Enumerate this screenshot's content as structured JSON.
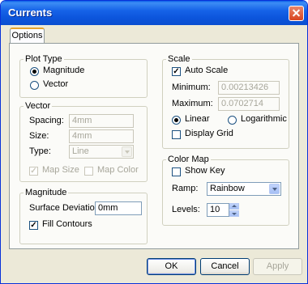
{
  "window": {
    "title": "Currents"
  },
  "tabs": [
    {
      "label": "Options"
    }
  ],
  "plot_type": {
    "legend": "Plot Type",
    "options": [
      {
        "label": "Magnitude",
        "selected": true
      },
      {
        "label": "Vector",
        "selected": false
      }
    ]
  },
  "vector": {
    "legend": "Vector",
    "spacing_label": "Spacing:",
    "spacing_value": "4mm",
    "size_label": "Size:",
    "size_value": "4mm",
    "type_label": "Type:",
    "type_value": "Line",
    "map_size_label": "Map Size",
    "map_size_checked": true,
    "map_color_label": "Map Color",
    "map_color_checked": false
  },
  "magnitude": {
    "legend": "Magnitude",
    "surface_deviation_label": "Surface Deviation:",
    "surface_deviation_value": "0mm",
    "fill_contours_label": "Fill Contours",
    "fill_contours_checked": true
  },
  "scale": {
    "legend": "Scale",
    "auto_scale_label": "Auto Scale",
    "auto_scale_checked": true,
    "minimum_label": "Minimum:",
    "minimum_value": "0.00213426",
    "maximum_label": "Maximum:",
    "maximum_value": "0.0702714",
    "linear_label": "Linear",
    "linear_selected": true,
    "logarithmic_label": "Logarithmic",
    "logarithmic_selected": false,
    "display_grid_label": "Display Grid",
    "display_grid_checked": false
  },
  "color_map": {
    "legend": "Color Map",
    "show_key_label": "Show Key",
    "show_key_checked": false,
    "ramp_label": "Ramp:",
    "ramp_value": "Rainbow",
    "levels_label": "Levels:",
    "levels_value": "10"
  },
  "buttons": {
    "ok": "OK",
    "cancel": "Cancel",
    "apply": "Apply"
  },
  "colors": {
    "title_bar": "#0a5fe8",
    "dialog_bg": "#ece9d8",
    "accent": "#21a121"
  },
  "icons": {
    "close": "close-icon",
    "checkmark": "check-mark-icon",
    "dropdown": "chevron-down-icon"
  }
}
